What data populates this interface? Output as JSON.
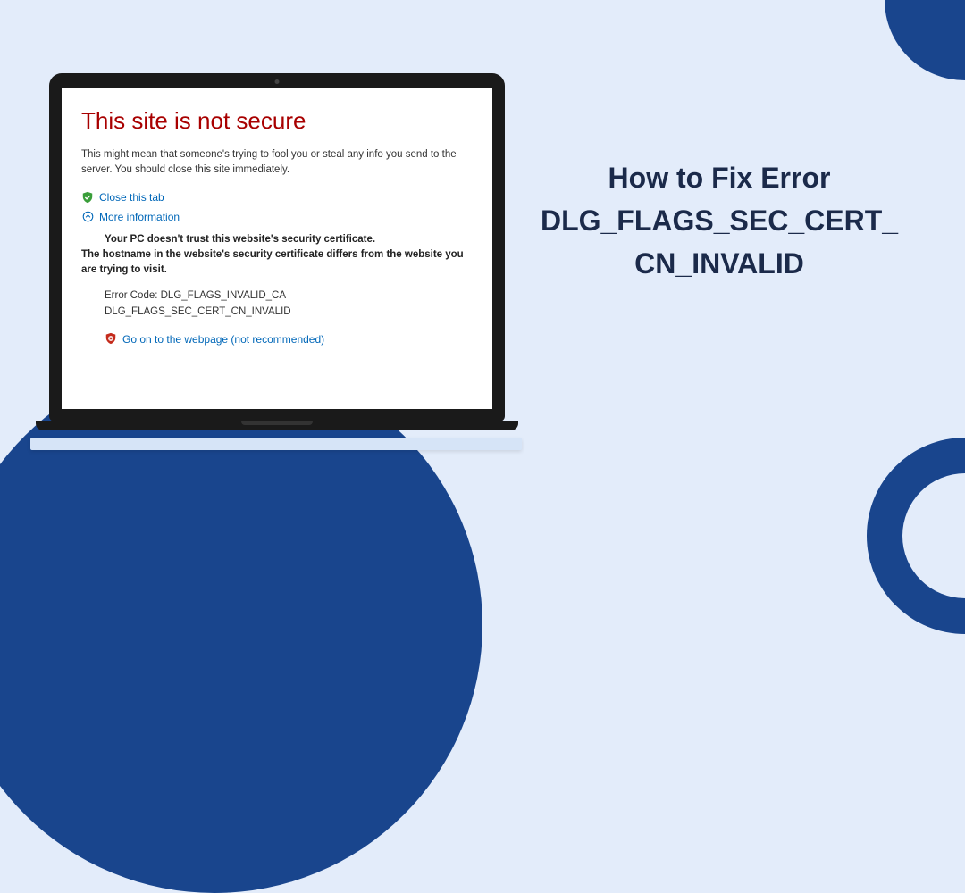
{
  "decor": {
    "bg_color": "#e3ecfa",
    "accent_color": "#19458d"
  },
  "headline": {
    "line1": "How to Fix Error",
    "line2": "DLG_FLAGS_SEC_CERT_",
    "line3": "CN_INVALID"
  },
  "error_page": {
    "title": "This site is not secure",
    "description": "This might mean that someone's trying to fool you or steal any info you send to the server. You should close this site immediately.",
    "close_tab_label": "Close this tab",
    "more_info_label": "More information",
    "trust_line1_prefix": "Your PC doesn't trust this website's security certificate.",
    "trust_line2": "The hostname in the website's security certificate differs from the website you are trying to visit.",
    "error_code_line1": "Error Code: DLG_FLAGS_INVALID_CA",
    "error_code_line2": "DLG_FLAGS_SEC_CERT_CN_INVALID",
    "go_on_label": "Go on to the webpage (not recommended)"
  }
}
